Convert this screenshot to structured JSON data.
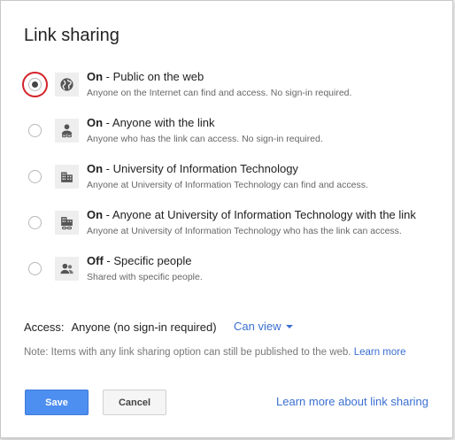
{
  "dialog": {
    "title": "Link sharing"
  },
  "options": [
    {
      "status": "On",
      "separator": " - ",
      "label": "Public on the web",
      "description": "Anyone on the Internet can find and access. No sign-in required.",
      "icon": "globe-icon",
      "selected": true
    },
    {
      "status": "On",
      "separator": " - ",
      "label": "Anyone with the link",
      "description": "Anyone who has the link can access. No sign-in required.",
      "icon": "person-link-icon",
      "selected": false
    },
    {
      "status": "On",
      "separator": " - ",
      "label": "University of Information Technology",
      "description": "Anyone at University of Information Technology can find and access.",
      "icon": "building-icon",
      "selected": false
    },
    {
      "status": "On",
      "separator": " - ",
      "label": "Anyone at University of Information Technology with the link",
      "description": "Anyone at University of Information Technology who has the link can access.",
      "icon": "building-link-icon",
      "selected": false
    },
    {
      "status": "Off",
      "separator": " - ",
      "label": "Specific people",
      "description": "Shared with specific people.",
      "icon": "people-icon",
      "selected": false
    }
  ],
  "access": {
    "label": "Access:",
    "value": "Anyone (no sign-in required)",
    "dropdown_selected": "Can view"
  },
  "note": {
    "text": "Note: Items with any link sharing option can still be published to the web.",
    "link": "Learn more"
  },
  "footer": {
    "save_label": "Save",
    "cancel_label": "Cancel",
    "learn_more_label": "Learn more about link sharing"
  },
  "colors": {
    "accent_link": "#3b6fd1",
    "save_button": "#4d8ff0",
    "highlight_ring": "#d2232a"
  }
}
